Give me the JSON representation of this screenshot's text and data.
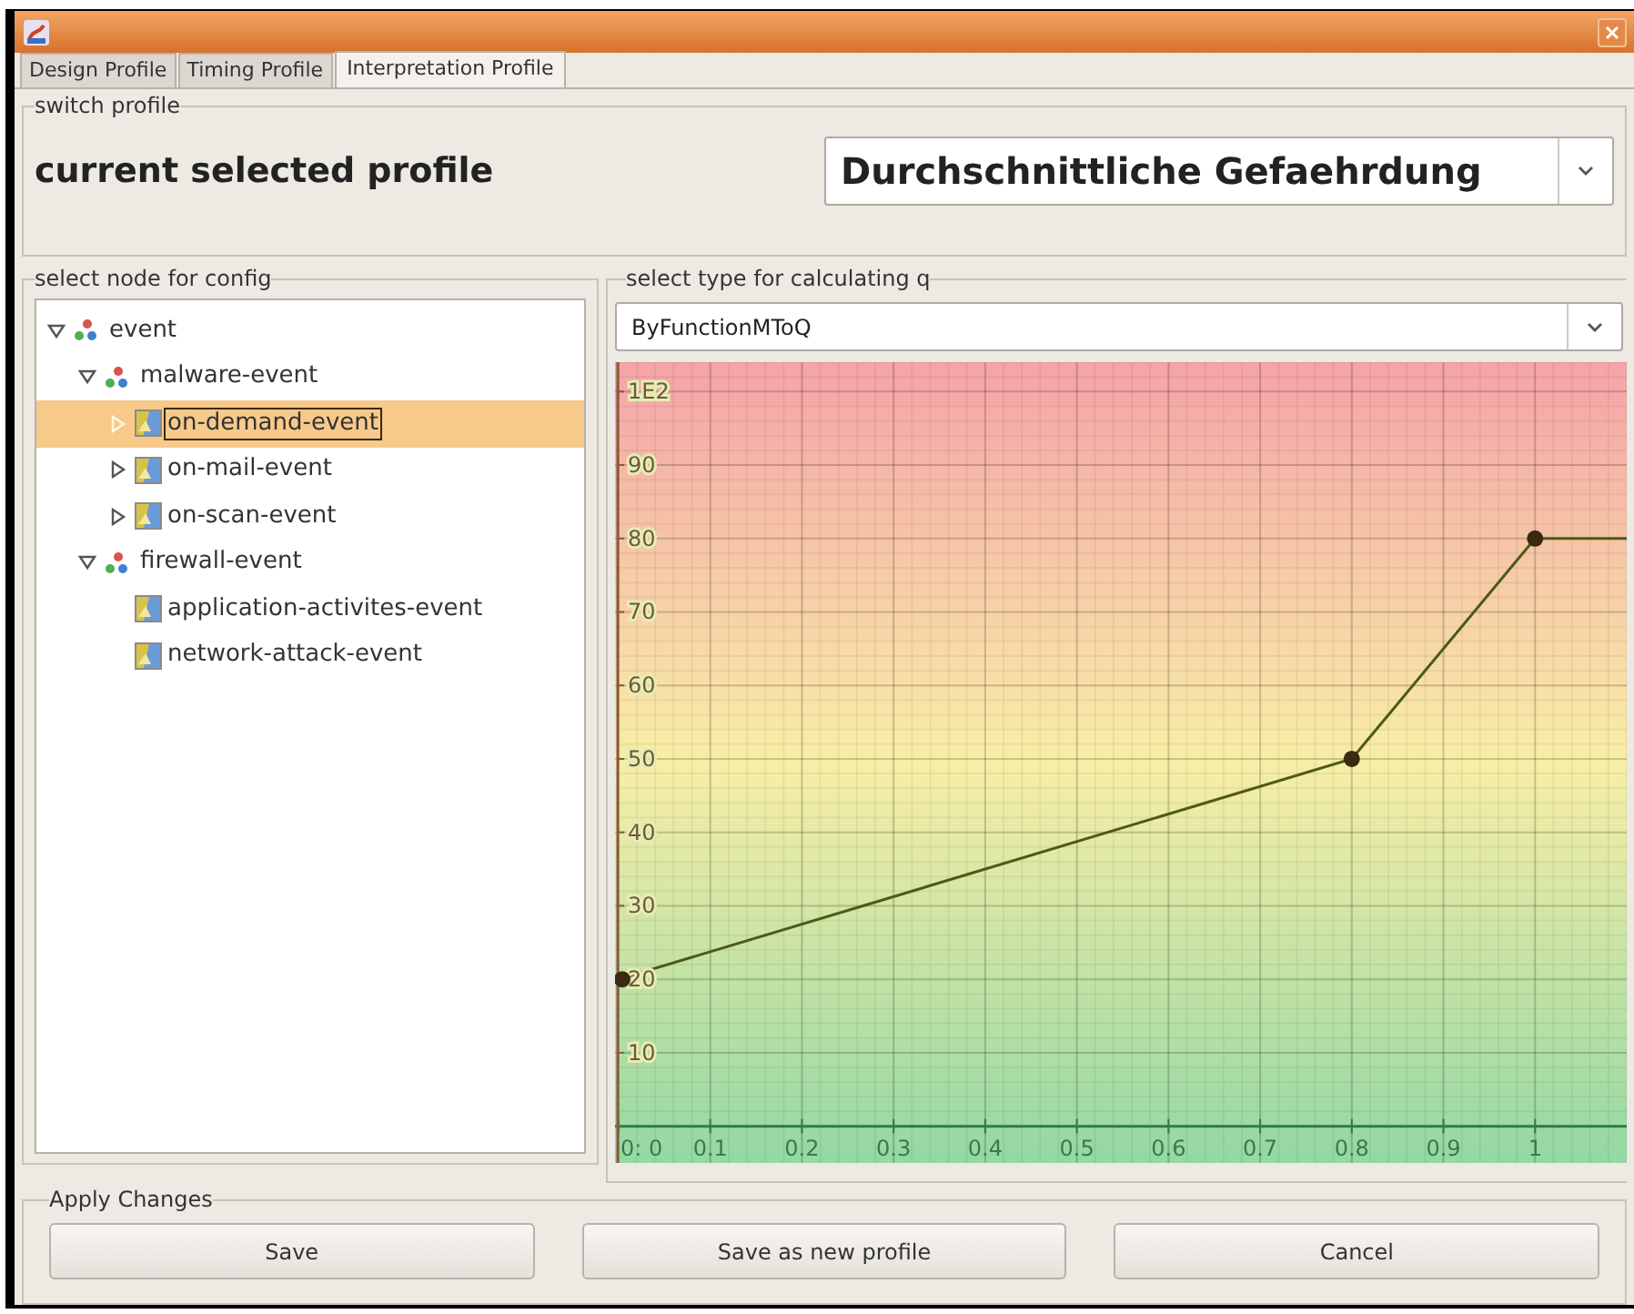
{
  "tabs": [
    {
      "label": "Design Profile",
      "selected": false
    },
    {
      "label": "Timing Profile",
      "selected": false
    },
    {
      "label": "Interpretation Profile",
      "selected": true
    }
  ],
  "switch_profile": {
    "legend": "switch profile",
    "label": "current selected profile",
    "value": "Durchschnittliche Gefaehrdung"
  },
  "node_tree": {
    "legend": "select node for config",
    "items": [
      {
        "label": "event",
        "kind": "group",
        "expanded": true,
        "selected": false,
        "children": [
          {
            "label": "malware-event",
            "kind": "group",
            "expanded": true,
            "selected": false,
            "children": [
              {
                "label": "on-demand-event",
                "kind": "leaf",
                "expanded": false,
                "selected": true
              },
              {
                "label": "on-mail-event",
                "kind": "leaf",
                "expanded": false,
                "selected": false
              },
              {
                "label": "on-scan-event",
                "kind": "leaf",
                "expanded": false,
                "selected": false
              }
            ]
          },
          {
            "label": "firewall-event",
            "kind": "group",
            "expanded": true,
            "selected": false,
            "children": [
              {
                "label": "application-activites-event",
                "kind": "leaf",
                "selected": false
              },
              {
                "label": "network-attack-event",
                "kind": "leaf",
                "selected": false
              }
            ]
          }
        ]
      }
    ]
  },
  "calc_type": {
    "legend": "select type for calculating q",
    "value": "ByFunctionMToQ",
    "chart_data": {
      "type": "line",
      "x": [
        0,
        0.8,
        1,
        1.1
      ],
      "series": [
        {
          "color": "#4d5a16",
          "marker": "circle",
          "values": [
            20,
            50,
            80,
            80
          ]
        }
      ],
      "ref_lines": [
        {
          "axis": "y",
          "value": 0,
          "color": "#2e7d4a"
        }
      ],
      "grid": true,
      "xlim": [
        0,
        1.1
      ],
      "ylim": [
        -5,
        104
      ],
      "xticks": [
        {
          "value": 0,
          "label": "0: 0"
        },
        0.1,
        0.2,
        0.3,
        0.4,
        0.5,
        0.6,
        0.7,
        0.8,
        0.9,
        {
          "value": 1,
          "label": "1"
        }
      ],
      "yticks": [
        10,
        20,
        30,
        40,
        50,
        60,
        70,
        80,
        90,
        {
          "value": 100,
          "label": "1E2"
        }
      ]
    }
  },
  "apply_changes": {
    "legend": "Apply Changes",
    "buttons": [
      "Save",
      "Save as new profile",
      "Cancel"
    ]
  }
}
